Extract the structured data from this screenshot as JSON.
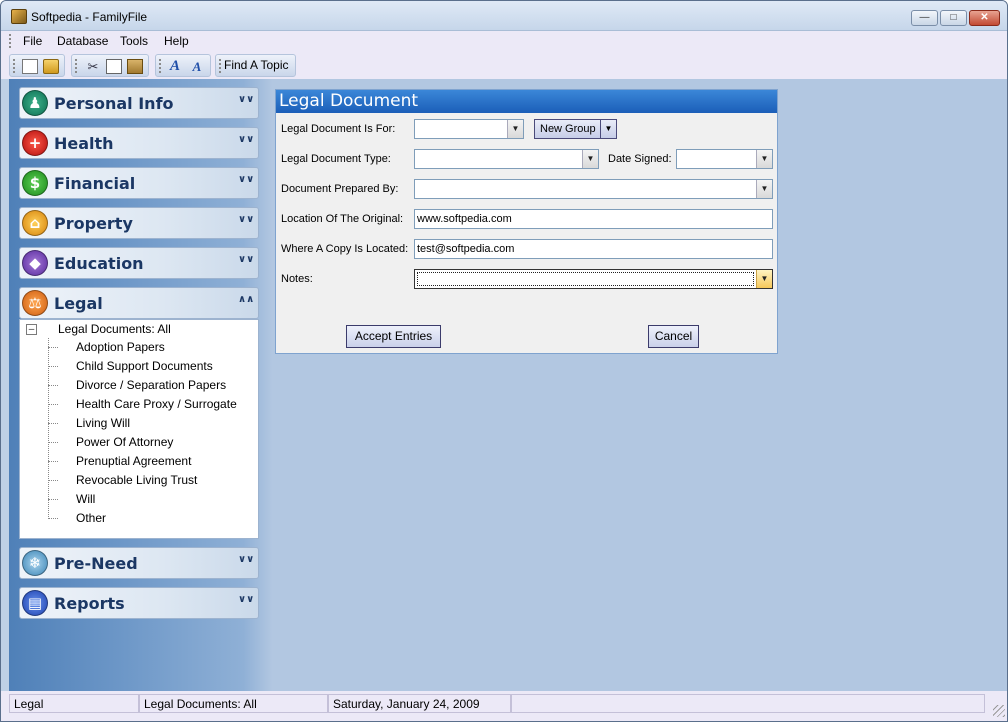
{
  "window": {
    "title": "Softpedia - FamilyFile"
  },
  "menu": [
    "File",
    "Database",
    "Tools",
    "Help"
  ],
  "toolbar": {
    "find_label": "Find A Topic"
  },
  "sidebar": {
    "sections": [
      {
        "label": "Personal Info",
        "icon": "person-icon",
        "color": "#0b6e52"
      },
      {
        "label": "Health",
        "icon": "cross-icon",
        "color": "#b10c0c",
        "glyph": "+"
      },
      {
        "label": "Financial",
        "icon": "dollar-icon",
        "color": "#1b8a1b",
        "glyph": "$"
      },
      {
        "label": "Property",
        "icon": "house-icon",
        "color": "#d5820b"
      },
      {
        "label": "Education",
        "icon": "graduation-cap-icon",
        "color": "#57299d"
      },
      {
        "label": "Legal",
        "icon": "scales-icon",
        "color": "#cd5c10"
      },
      {
        "label": "Pre-Need",
        "icon": "snowflake-icon",
        "color": "#3b84b5"
      },
      {
        "label": "Reports",
        "icon": "document-icon",
        "color": "#1b3fae"
      }
    ],
    "tree": {
      "root": "Legal Documents: All",
      "items": [
        "Adoption Papers",
        "Child Support Documents",
        "Divorce / Separation Papers",
        "Health Care Proxy / Surrogate",
        "Living Will",
        "Power Of Attorney",
        "Prenuptial Agreement",
        "Revocable Living Trust",
        "Will",
        "Other"
      ]
    }
  },
  "form": {
    "title": "Legal Document",
    "for_label": "Legal Document Is For:",
    "for_value": "",
    "new_group_label": "New Group",
    "type_label": "Legal Document Type:",
    "type_value": "",
    "date_label": "Date Signed:",
    "date_value": "",
    "prepared_label": "Document Prepared By:",
    "prepared_value": "",
    "location_label": "Location Of The Original:",
    "location_value": "www.softpedia.com",
    "copy_label": "Where A Copy Is Located:",
    "copy_value": "test@softpedia.com",
    "notes_label": "Notes:",
    "notes_value": "",
    "accept_label": "Accept Entries",
    "cancel_label": "Cancel"
  },
  "statusbar": [
    "Legal",
    "Legal Documents: All",
    "Saturday, January 24, 2009",
    ""
  ]
}
